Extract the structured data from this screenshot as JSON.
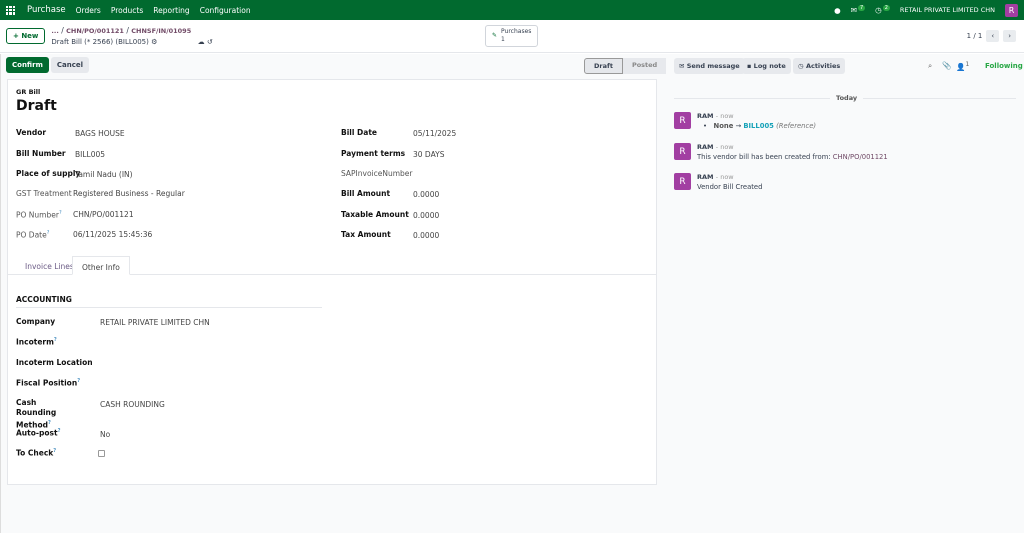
{
  "nav": {
    "app": "Purchase",
    "menus": [
      "Orders",
      "Products",
      "Reporting",
      "Configuration"
    ],
    "messages_count": "7",
    "activities_count": "2",
    "company": "RETAIL PRIVATE LIMITED CHN",
    "user_initial": "R"
  },
  "control": {
    "new_label": "New",
    "breadcrumb": [
      "...",
      "CHN/PO/001121",
      "CHNSF/IN/01095"
    ],
    "record_title": "Draft Bill (* 2566) (BILL005)",
    "smart_button": {
      "label": "Purchases",
      "count": "1"
    },
    "pager": "1 / 1"
  },
  "actions": {
    "confirm": "Confirm",
    "cancel": "Cancel"
  },
  "statusbar": [
    "Draft",
    "Posted"
  ],
  "form": {
    "subtitle": "GR Bill",
    "title": "Draft",
    "left": [
      {
        "label": "Vendor",
        "value": "BAGS HOUSE"
      },
      {
        "label": "Bill Number",
        "value": "BILL005"
      },
      {
        "label": "Place of supply",
        "value": "Tamil Nadu (IN)"
      },
      {
        "label": "GST Treatment",
        "value": "Registered Business - Regular"
      },
      {
        "label": "PO Number",
        "value": "CHN/PO/001121"
      },
      {
        "label": "PO Date",
        "value": "06/11/2025 15:45:36"
      }
    ],
    "right": [
      {
        "label": "Bill Date",
        "value": "05/11/2025"
      },
      {
        "label": "Payment terms",
        "value": "30 DAYS"
      },
      {
        "label": "SAPInvoiceNumber",
        "value": ""
      },
      {
        "label": "Bill Amount",
        "value": "0.0000"
      },
      {
        "label": "Taxable Amount",
        "value": "0.0000"
      },
      {
        "label": "Tax Amount",
        "value": "0.0000"
      }
    ],
    "tabs": [
      "Invoice Lines",
      "Other Info"
    ],
    "section": "ACCOUNTING",
    "accounting": [
      {
        "label": "Company",
        "value": "RETAIL PRIVATE LIMITED CHN"
      },
      {
        "label": "Incoterm",
        "value": ""
      },
      {
        "label": "Incoterm Location",
        "value": ""
      },
      {
        "label": "Fiscal Position",
        "value": ""
      },
      {
        "label": "Cash Rounding Method",
        "value": "CASH ROUNDING"
      },
      {
        "label": "Auto-post",
        "value": "No"
      },
      {
        "label": "To Check",
        "value": ""
      }
    ]
  },
  "chatter": {
    "send": "Send message",
    "log": "Log note",
    "activities": "Activities",
    "followers": "1",
    "following": "Following",
    "date": "Today",
    "messages": [
      {
        "author": "RAM",
        "time": "- now",
        "old": "None",
        "new": "BILL005",
        "field": "(Reference)"
      },
      {
        "author": "RAM",
        "time": "- now",
        "text": "This vendor bill has been created from:",
        "link": "CHN/PO/001121"
      },
      {
        "author": "RAM",
        "time": "- now",
        "text": "Vendor Bill Created"
      }
    ]
  }
}
